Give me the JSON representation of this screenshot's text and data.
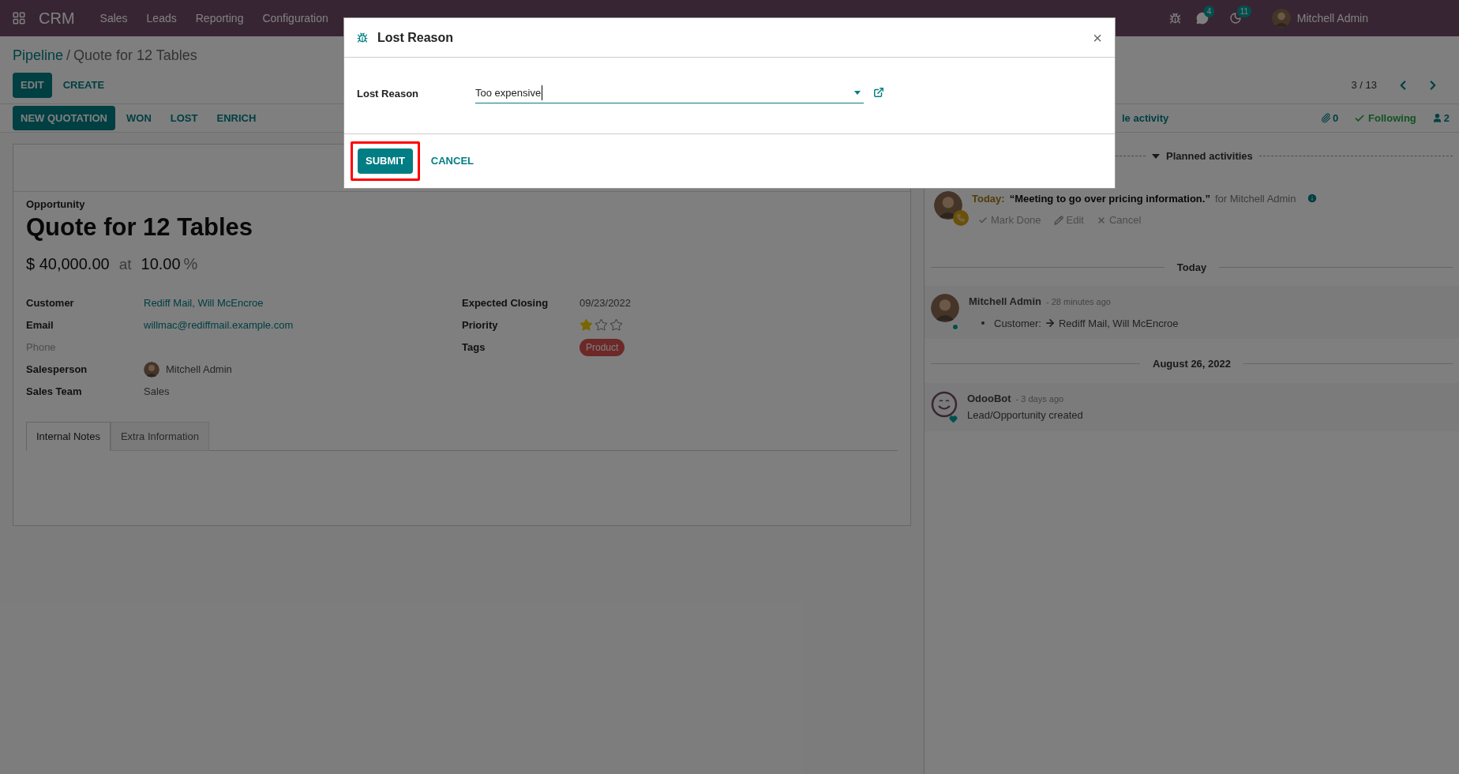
{
  "navbar": {
    "app": "CRM",
    "menu": [
      "Sales",
      "Leads",
      "Reporting",
      "Configuration"
    ],
    "chat_count": "4",
    "activity_count": "11",
    "user": "Mitchell Admin"
  },
  "breadcrumb": {
    "parent": "Pipeline",
    "separator": "/",
    "current": "Quote for 12 Tables"
  },
  "actions": [
    {
      "label": "EDIT",
      "kind": "primary"
    },
    {
      "label": "CREATE",
      "kind": "link"
    }
  ],
  "pager": "3 / 13",
  "header_buttons": [
    {
      "label": "NEW QUOTATION",
      "kind": "primary"
    },
    {
      "label": "WON",
      "kind": "link"
    },
    {
      "label": "LOST",
      "kind": "link"
    },
    {
      "label": "ENRICH",
      "kind": "link"
    }
  ],
  "form": {
    "type_label": "Opportunity",
    "title": "Quote for 12 Tables",
    "revenue": "$ 40,000.00",
    "at": "at",
    "probability": "10.00",
    "percent": "%",
    "left_fields": [
      {
        "label": "Customer",
        "value": "Rediff Mail, Will McEncroe",
        "kind": "link"
      },
      {
        "label": "Email",
        "value": "willmac@rediffmail.example.com",
        "kind": "link"
      },
      {
        "label": "Phone",
        "kind": "empty"
      },
      {
        "label": "Salesperson",
        "value": "Mitchell Admin",
        "kind": "user"
      },
      {
        "label": "Sales Team",
        "value": "Sales",
        "kind": "text"
      }
    ],
    "right_fields": [
      {
        "label": "Expected Closing",
        "value": "09/23/2022",
        "kind": "text"
      },
      {
        "label": "Priority",
        "kind": "stars",
        "stars": 1
      },
      {
        "label": "Tags",
        "value": "Product",
        "kind": "tag"
      }
    ],
    "tabs": [
      {
        "label": "Internal Notes",
        "selected": true
      },
      {
        "label": "Extra Information",
        "selected": false
      }
    ]
  },
  "chatter": {
    "topbar_partial": "le activity",
    "attachments": "0",
    "follow": "Following",
    "followers": "2",
    "planned_title": "Planned activities",
    "activity": {
      "when": "Today:",
      "summary": "“Meeting to go over pricing information.”",
      "assignee": "for Mitchell Admin",
      "actions": [
        "Mark Done",
        "Edit",
        "Cancel"
      ]
    },
    "groups": [
      {
        "date": "Today",
        "messages": [
          {
            "author": "Mitchell Admin",
            "time": "- 28 minutes ago",
            "kind": "tracking",
            "text": "Customer:",
            "value": "Rediff Mail, Will McEncroe"
          }
        ]
      },
      {
        "date": "August 26, 2022",
        "messages": [
          {
            "author": "OdooBot",
            "time": "- 3 days ago",
            "kind": "note",
            "text": "Lead/Opportunity created"
          }
        ]
      }
    ]
  },
  "dialog": {
    "title": "Lost Reason",
    "field_label": "Lost Reason",
    "field_value": "Too expensive",
    "buttons": [
      {
        "label": "SUBMIT",
        "kind": "primary",
        "highlighted": true
      },
      {
        "label": "CANCEL",
        "kind": "link",
        "highlighted": false
      }
    ],
    "close": "×"
  }
}
